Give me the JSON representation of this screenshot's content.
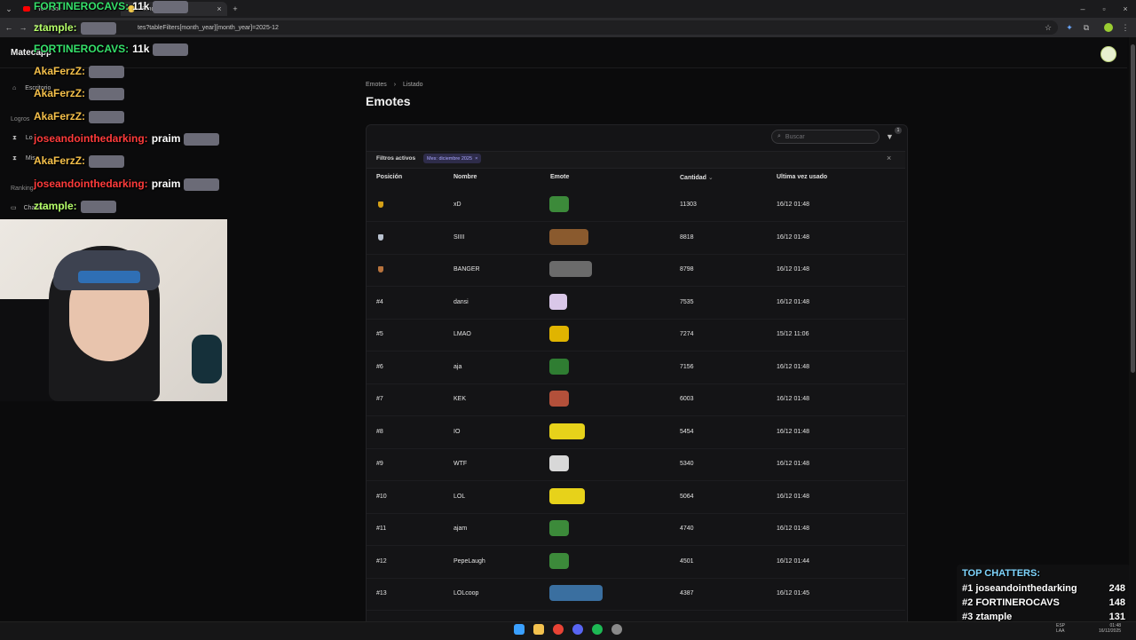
{
  "browser": {
    "tabs": [
      {
        "label": "YouTube",
        "active": false
      },
      {
        "label": "Emotes - Mat",
        "active": true
      }
    ],
    "url": "tes?tableFilters[month_year][month_year]=2025-12"
  },
  "app": {
    "name": "Matecapp",
    "sidebar": {
      "escritorio": "Escritorio",
      "logros_caption": "Logros",
      "logros": "Lo",
      "mis": "Mis",
      "ranking_caption": "Ranking",
      "chatters": "Chatters"
    }
  },
  "page": {
    "breadcrumb": [
      "Emotes",
      "Listado"
    ],
    "title": "Emotes",
    "search_placeholder": "Buscar",
    "filter_badge": "1",
    "filters_label": "Filtros activos",
    "filter_chip": "Mes: diciembre 2025",
    "columns": [
      "Posición",
      "Nombre",
      "Emote",
      "Cantidad",
      "Ultima vez usado"
    ],
    "rows": [
      {
        "pos": "",
        "medal": "#d4a017",
        "name": "xD",
        "count": "11303",
        "last": "16/12 01:48",
        "emote_color": "#3c8a3a",
        "emote_w": 22
      },
      {
        "pos": "",
        "medal": "#b9c2cf",
        "name": "SIIII",
        "count": "8818",
        "last": "16/12 01:48",
        "emote_color": "#8a5a2e",
        "emote_w": 44
      },
      {
        "pos": "",
        "medal": "#b8733d",
        "name": "BANGER",
        "count": "8798",
        "last": "16/12 01:48",
        "emote_color": "#6b6b6b",
        "emote_w": 48
      },
      {
        "pos": "#4",
        "medal": "",
        "name": "dansi",
        "count": "7535",
        "last": "16/12 01:48",
        "emote_color": "#d9c7e8",
        "emote_w": 20
      },
      {
        "pos": "#5",
        "medal": "",
        "name": "LMAO",
        "count": "7274",
        "last": "15/12 11:06",
        "emote_color": "#e0b400",
        "emote_w": 22
      },
      {
        "pos": "#6",
        "medal": "",
        "name": "aja",
        "count": "7156",
        "last": "16/12 01:48",
        "emote_color": "#2f7d32",
        "emote_w": 22
      },
      {
        "pos": "#7",
        "medal": "",
        "name": "KEK",
        "count": "6003",
        "last": "16/12 01:48",
        "emote_color": "#b3503a",
        "emote_w": 22
      },
      {
        "pos": "#8",
        "medal": "",
        "name": "IO",
        "count": "5454",
        "last": "16/12 01:48",
        "emote_color": "#e7d21a",
        "emote_w": 40
      },
      {
        "pos": "#9",
        "medal": "",
        "name": "WTF",
        "count": "5340",
        "last": "16/12 01:48",
        "emote_color": "#d8d8d8",
        "emote_w": 22
      },
      {
        "pos": "#10",
        "medal": "",
        "name": "LOL",
        "count": "5064",
        "last": "16/12 01:48",
        "emote_color": "#e7d21a",
        "emote_w": 40
      },
      {
        "pos": "#11",
        "medal": "",
        "name": "ajam",
        "count": "4740",
        "last": "16/12 01:48",
        "emote_color": "#3c8a3a",
        "emote_w": 22
      },
      {
        "pos": "#12",
        "medal": "",
        "name": "PepeLaugh",
        "count": "4501",
        "last": "16/12 01:44",
        "emote_color": "#3c8a3a",
        "emote_w": 22
      },
      {
        "pos": "#13",
        "medal": "",
        "name": "LOLcoop",
        "count": "4387",
        "last": "16/12 01:45",
        "emote_color": "#3a6fa0",
        "emote_w": 60
      }
    ]
  },
  "chat_overlay": [
    {
      "user": "FORTINEROCAVS:",
      "text": "11k",
      "color": "#35e06a"
    },
    {
      "user": "ztample:",
      "text": "",
      "color": "#b6ff6a"
    },
    {
      "user": "FORTINEROCAVS:",
      "text": "11k",
      "color": "#35e06a"
    },
    {
      "user": "AkaFerzZ:",
      "text": "",
      "color": "#f5c04a"
    },
    {
      "user": "AkaFerzZ:",
      "text": "",
      "color": "#f5c04a"
    },
    {
      "user": "AkaFerzZ:",
      "text": "",
      "color": "#f5c04a"
    },
    {
      "user": "joseandointhedarking:",
      "text": "praim",
      "color": "#ff3b3b"
    },
    {
      "user": "AkaFerzZ:",
      "text": "",
      "color": "#f5c04a"
    },
    {
      "user": "joseandointhedarking:",
      "text": "praim",
      "color": "#ff3b3b"
    },
    {
      "user": "ztample:",
      "text": "",
      "color": "#b6ff6a"
    }
  ],
  "top_chatters": {
    "title": "TOP CHATTERS:",
    "entries": [
      {
        "rank": "#1",
        "name": "joseandointhedarking",
        "count": "248"
      },
      {
        "rank": "#2",
        "name": "FORTINEROCAVS",
        "count": "148"
      },
      {
        "rank": "#3",
        "name": "ztample",
        "count": "131"
      }
    ]
  },
  "taskbar": {
    "lang_top": "ESP",
    "lang_bottom": "LAA",
    "time": "01:48",
    "date": "16/12/2025"
  }
}
